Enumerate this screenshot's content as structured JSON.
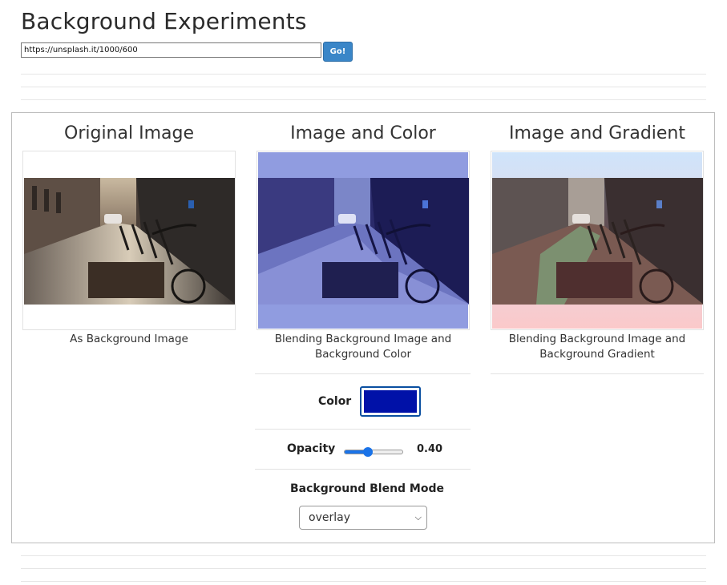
{
  "header": {
    "title": "Background Experiments",
    "url_value": "https://unsplash.it/1000/600",
    "go_label": "Go!"
  },
  "columns": {
    "original": {
      "title": "Original Image",
      "caption": "As Background Image"
    },
    "color": {
      "title": "Image and Color",
      "caption_line1": "Blending Background Image and",
      "caption_line2": "Background Color"
    },
    "gradient": {
      "title": "Image and Gradient",
      "caption_line1": "Blending Background Image and",
      "caption_line2": "Background Gradient"
    }
  },
  "controls": {
    "color_label": "Color",
    "color_value": "#0011a8",
    "opacity_label": "Opacity",
    "opacity_value": "0.40",
    "opacity_fraction": 0.4,
    "blend_label": "Background Blend Mode",
    "blend_selected": "overlay"
  },
  "colors": {
    "go_button": "#3a86c8",
    "color_overlay": "#909ce0",
    "gradient_top": "#cfe4fb",
    "gradient_bottom": "#fbc9ca"
  }
}
